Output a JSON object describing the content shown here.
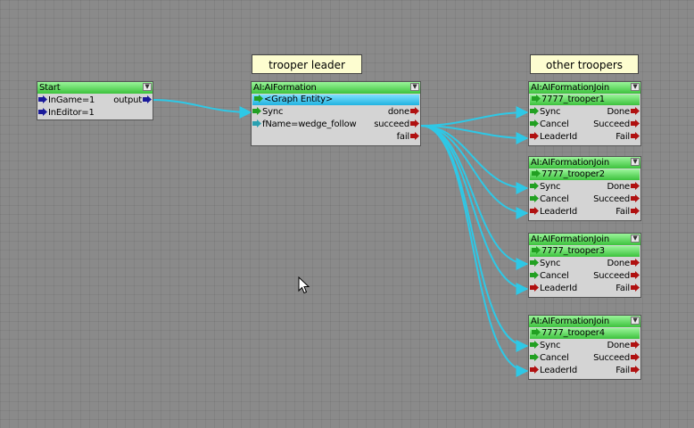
{
  "comments": {
    "trooper_leader": "trooper leader",
    "other_troopers": "other troopers"
  },
  "start_node": {
    "title": "Start",
    "ports": {
      "ingame": "InGame=1",
      "ineditor": "InEditor=1",
      "output": "output"
    }
  },
  "formation_node": {
    "title": "AI:AIFormation",
    "entity": "<Graph Entity>",
    "ports": {
      "sync": "Sync",
      "fname": "fName=wedge_follow",
      "done": "done",
      "succeed": "succeed",
      "fail": "fail"
    }
  },
  "join_nodes": [
    {
      "title": "AI:AIFormationJoin",
      "entity": "7777_trooper1",
      "sync": "Sync",
      "cancel": "Cancel",
      "leaderid": "LeaderId",
      "done": "Done",
      "succeed": "Succeed",
      "fail": "Fail"
    },
    {
      "title": "AI:AIFormationJoin",
      "entity": "7777_trooper2",
      "sync": "Sync",
      "cancel": "Cancel",
      "leaderid": "LeaderId",
      "done": "Done",
      "succeed": "Succeed",
      "fail": "Fail"
    },
    {
      "title": "AI:AIFormationJoin",
      "entity": "7777_trooper3",
      "sync": "Sync",
      "cancel": "Cancel",
      "leaderid": "LeaderId",
      "done": "Done",
      "succeed": "Succeed",
      "fail": "Fail"
    },
    {
      "title": "AI:AIFormationJoin",
      "entity": "7777_trooper4",
      "sync": "Sync",
      "cancel": "Cancel",
      "leaderid": "LeaderId",
      "done": "Done",
      "succeed": "Succeed",
      "fail": "Fail"
    }
  ],
  "colors": {
    "wire": "#2ec8e6",
    "port_in_green": "#22a022",
    "port_out_red": "#b01010",
    "port_blue": "#1a1a9a",
    "port_teal": "#2aa0b0"
  }
}
